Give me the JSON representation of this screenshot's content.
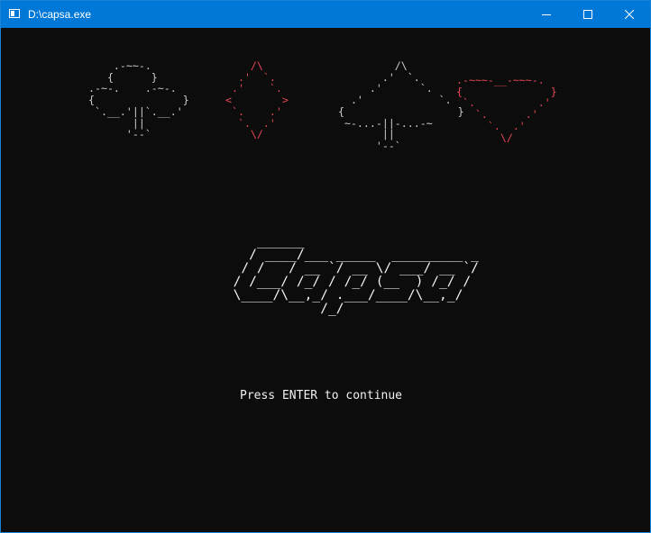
{
  "window": {
    "title": "D:\\capsa.exe"
  },
  "suits": {
    "club": "    .-~~-.\n   {      }\n.-~-.    .-~-.\n{              }\n `.__.'||`.__.'\n       ||\n      '--`",
    "diamond": "    /\\\n  .'  `.\n .'    `.\n<        >\n `.    .'\n  `.  .'\n    \\/",
    "spade": "          /\\\n        .'  `.\n      .'      `.\n   .'            `.\n {                  }\n  ~-...-||-...-~\n        ||\n       '--`",
    "heart": ".-~~~-__-~~~-.\n{              }\n `.          .'\n   `.      .'\n     `.  .'\n       \\/"
  },
  "logo": {
    "text": "     ______\n    / ____/___ _____  _________ _\n   / /   / __ `/ __ \\/ ___/ __ `/\n  / /___/ /_/ / /_/ (__  ) /_/ /\n  \\____/\\__,_/ .___/____/\\__,_/\n             /_/"
  },
  "prompt": {
    "text": "Press ENTER to continue"
  },
  "colors": {
    "titlebar": "#0078d7",
    "console_bg": "#0c0c0c",
    "red_suit": "#e74856",
    "white_suit": "#cccccc"
  }
}
